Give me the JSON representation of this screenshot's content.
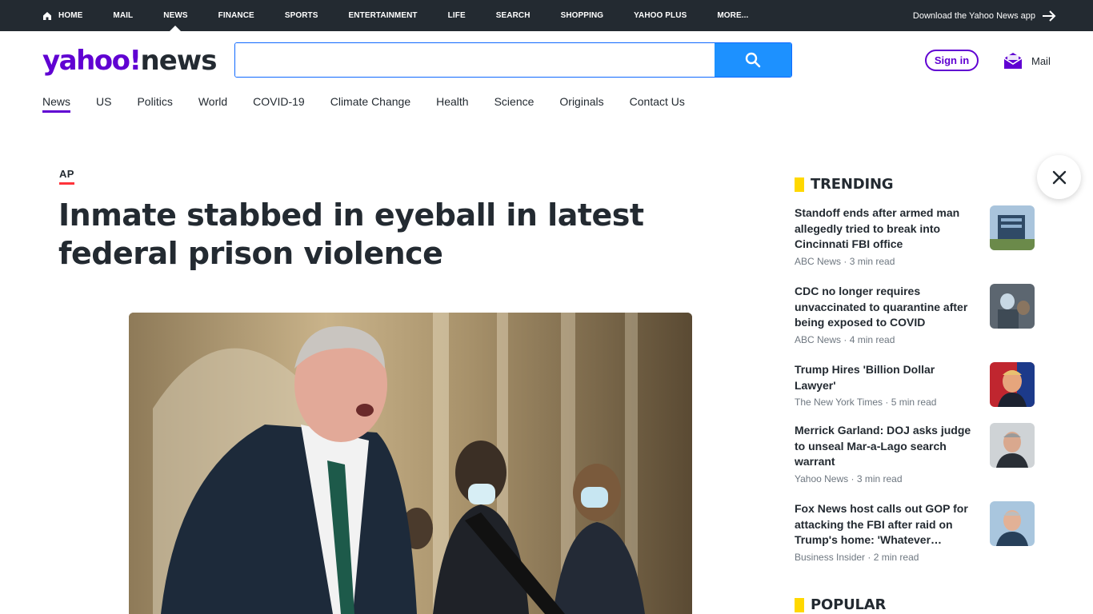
{
  "topnav": {
    "items": [
      {
        "label": "Home",
        "icon": "home-icon"
      },
      {
        "label": "Mail"
      },
      {
        "label": "News",
        "active": true
      },
      {
        "label": "Finance"
      },
      {
        "label": "Sports"
      },
      {
        "label": "Entertainment"
      },
      {
        "label": "Life"
      },
      {
        "label": "Search"
      },
      {
        "label": "Shopping"
      },
      {
        "label": "Yahoo Plus"
      },
      {
        "label": "More..."
      }
    ],
    "download_app": "Download the Yahoo News app"
  },
  "logo": {
    "brand": "yahoo!",
    "section": "news"
  },
  "search": {
    "placeholder": ""
  },
  "header": {
    "signin": "Sign in",
    "mail": "Mail"
  },
  "subnav": {
    "items": [
      "News",
      "US",
      "Politics",
      "World",
      "COVID-19",
      "Climate Change",
      "Health",
      "Science",
      "Originals",
      "Contact Us"
    ]
  },
  "article": {
    "source": "AP",
    "headline": "Inmate stabbed in eyeball in latest federal prison violence"
  },
  "trending": {
    "title": "Trending",
    "items": [
      {
        "title": "Standoff ends after armed man allegedly tried to break into Cincinnati FBI office",
        "publisher": "ABC News",
        "read": "3 min read"
      },
      {
        "title": "CDC no longer requires unvaccinated to quarantine after being exposed to COVID",
        "publisher": "ABC News",
        "read": "4 min read"
      },
      {
        "title": "Trump Hires 'Billion Dollar Lawyer'",
        "publisher": "The New York Times",
        "read": "5 min read"
      },
      {
        "title": "Merrick Garland: DOJ asks judge to unseal Mar-a-Lago search warrant",
        "publisher": "Yahoo News",
        "read": "3 min read"
      },
      {
        "title": "Fox News host calls out GOP for attacking the FBI after raid on Trump's home: 'Whatever…",
        "publisher": "Business Insider",
        "read": "2 min read"
      }
    ]
  },
  "popular": {
    "title": "Popular"
  },
  "colors": {
    "brand": "#6001d2",
    "search_button": "#1d91ff",
    "trending_bar": "#ffd800",
    "source_underline": "#ff333a",
    "topbar": "#232a31"
  }
}
